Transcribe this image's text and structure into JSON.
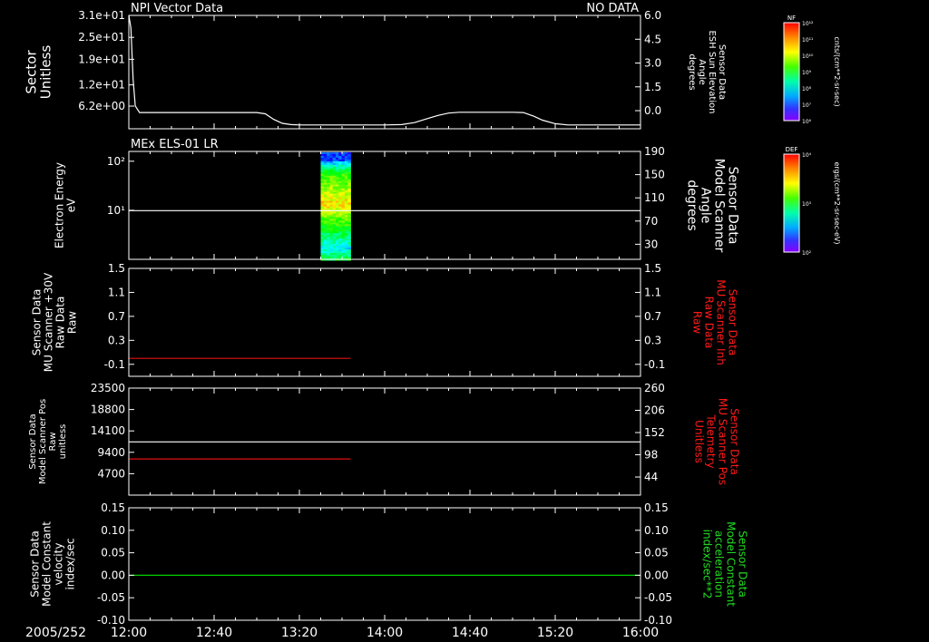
{
  "colors": {
    "background": "#000000",
    "axes": "#ffffff",
    "trace_white": "#ffffff",
    "trace_red": "#e01010",
    "trace_green": "#00d000",
    "label_red": "#ff1a1a",
    "label_green": "#22dd22"
  },
  "time_axis": {
    "date_label": "2005/252",
    "ticks": [
      "12:00",
      "12:40",
      "13:20",
      "14:00",
      "14:40",
      "15:20",
      "16:00"
    ],
    "tick_minutes": [
      0,
      40,
      80,
      120,
      160,
      200,
      240
    ],
    "range_minutes": [
      0,
      240
    ]
  },
  "colorbars": [
    {
      "tag": "NF",
      "unit": "cnts/(cm**2-sr-sec)",
      "ticks": [
        "10¹²",
        "10¹¹",
        "10¹⁰",
        "10⁹",
        "10⁸",
        "10⁷",
        "10⁶"
      ]
    },
    {
      "tag": "DEF",
      "unit": "ergs/(cm**2-sr-sec-eV)",
      "ticks": [
        "10⁴",
        "10³",
        "10²"
      ]
    }
  ],
  "chart_data": [
    {
      "type": "line",
      "title": "NPI Vector Data",
      "status": "NO DATA",
      "left_label": [
        "Sector",
        "Unitless"
      ],
      "right_label": [
        "Sensor Data",
        "ESH Sun Elevation",
        "Angle",
        "degrees"
      ],
      "left_ticks": [
        "3.1e+01",
        "2.5e+01",
        "1.9e+01",
        "1.2e+01",
        "6.2e+00"
      ],
      "left_values": [
        31,
        25,
        19,
        12,
        6.2
      ],
      "ylim_left": [
        0,
        31
      ],
      "right_ticks": [
        "6.0",
        "4.5",
        "3.0",
        "1.5",
        "0.0"
      ],
      "right_values": [
        6.0,
        4.5,
        3.0,
        1.5,
        0.0
      ],
      "ylim_right": [
        -1.14,
        6.0
      ],
      "series": [
        {
          "color": "#ffffff",
          "axis": "right",
          "x": [
            0,
            1,
            2,
            3,
            5,
            8,
            15,
            20,
            30,
            40,
            50,
            55,
            60,
            64,
            68,
            72,
            76,
            80,
            85,
            90,
            95,
            100,
            110,
            120,
            128,
            134,
            140,
            145,
            150,
            155,
            160,
            165,
            170,
            175,
            180,
            185,
            190,
            194,
            200,
            206,
            212,
            220,
            230,
            240
          ],
          "y": [
            6.0,
            5.2,
            2.0,
            0.3,
            -0.12,
            -0.12,
            -0.12,
            -0.12,
            -0.12,
            -0.12,
            -0.12,
            -0.12,
            -0.12,
            -0.2,
            -0.55,
            -0.8,
            -0.88,
            -0.9,
            -0.9,
            -0.9,
            -0.9,
            -0.9,
            -0.9,
            -0.9,
            -0.88,
            -0.75,
            -0.5,
            -0.3,
            -0.15,
            -0.1,
            -0.1,
            -0.1,
            -0.1,
            -0.1,
            -0.1,
            -0.12,
            -0.35,
            -0.6,
            -0.82,
            -0.9,
            -0.9,
            -0.9,
            -0.9,
            -0.9
          ]
        }
      ]
    },
    {
      "type": "heatmap",
      "title": "MEx ELS-01 LR",
      "left_label": [
        "Electron Energy",
        "eV"
      ],
      "right_label": [
        "Sensor Data",
        "Model Scanner",
        "Angle",
        "degrees"
      ],
      "left_ticks": [
        "10²",
        "10¹"
      ],
      "left_log_values": [
        2,
        1
      ],
      "ylim_left_log": [
        0.0,
        2.2
      ],
      "right_ticks": [
        "190",
        "150",
        "110",
        "70",
        "30"
      ],
      "right_values": [
        190,
        150,
        110,
        70,
        30
      ],
      "ylim_right": [
        4,
        190
      ],
      "spectrogram_x_range": [
        90,
        104
      ],
      "series": [
        {
          "color": "#ffffff",
          "axis": "right",
          "x": [
            0,
            240
          ],
          "y": [
            88,
            88
          ]
        }
      ]
    },
    {
      "type": "line",
      "left_label": [
        "Sensor Data",
        "MU Scanner +30V",
        "Raw Data",
        "Raw"
      ],
      "right_label": [
        "Sensor Data",
        "MU Scanner Inh",
        "Raw Data",
        "Raw"
      ],
      "left_ticks": [
        "1.5",
        "1.1",
        "0.7",
        "0.3",
        "-0.1"
      ],
      "left_values": [
        1.5,
        1.1,
        0.7,
        0.3,
        -0.1
      ],
      "ylim_left": [
        -0.3,
        1.5
      ],
      "right_ticks": [
        "1.5",
        "1.1",
        "0.7",
        "0.3",
        "-0.1"
      ],
      "right_values": [
        1.5,
        1.1,
        0.7,
        0.3,
        -0.1
      ],
      "ylim_right": [
        -0.3,
        1.5
      ],
      "series": [
        {
          "color": "#e01010",
          "axis": "left",
          "x": [
            0,
            104
          ],
          "y": [
            0.0,
            0.0
          ]
        }
      ]
    },
    {
      "type": "line",
      "left_label": [
        "Sensor Data",
        "Model Scanner Pos",
        "Raw",
        "unitless"
      ],
      "right_label": [
        "Sensor Data",
        "MU Scanner Pos",
        "Telemetry",
        "Unitless"
      ],
      "left_ticks": [
        "23500",
        "18800",
        "14100",
        "9400",
        "4700"
      ],
      "left_values": [
        23500,
        18800,
        14100,
        9400,
        4700
      ],
      "ylim_left": [
        0,
        23500
      ],
      "right_ticks": [
        "260",
        "206",
        "152",
        "98",
        "44"
      ],
      "right_values": [
        260,
        206,
        152,
        98,
        44
      ],
      "ylim_right": [
        0,
        260
      ],
      "series": [
        {
          "color": "#ffffff",
          "axis": "left",
          "x": [
            0,
            240
          ],
          "y": [
            11700,
            11700
          ]
        },
        {
          "color": "#e01010",
          "axis": "left",
          "x": [
            0,
            104
          ],
          "y": [
            7950,
            7950
          ]
        }
      ]
    },
    {
      "type": "line",
      "left_label": [
        "Sensor Data",
        "Model Constant",
        "velocity",
        "index/sec"
      ],
      "right_label": [
        "Sensor Data",
        "Model Constant",
        "acceleration",
        "index/sec**2"
      ],
      "left_ticks": [
        "0.15",
        "0.10",
        "0.05",
        "0.00",
        "-0.05",
        "-0.10"
      ],
      "left_values": [
        0.15,
        0.1,
        0.05,
        0.0,
        -0.05,
        -0.1
      ],
      "ylim_left": [
        -0.1,
        0.15
      ],
      "right_ticks": [
        "0.15",
        "0.10",
        "0.05",
        "0.00",
        "-0.05",
        "-0.10"
      ],
      "right_values": [
        0.15,
        0.1,
        0.05,
        0.0,
        -0.05,
        -0.1
      ],
      "ylim_right": [
        -0.1,
        0.15
      ],
      "series": [
        {
          "color": "#00d000",
          "axis": "left",
          "x": [
            0,
            240
          ],
          "y": [
            0,
            0
          ]
        }
      ]
    }
  ]
}
